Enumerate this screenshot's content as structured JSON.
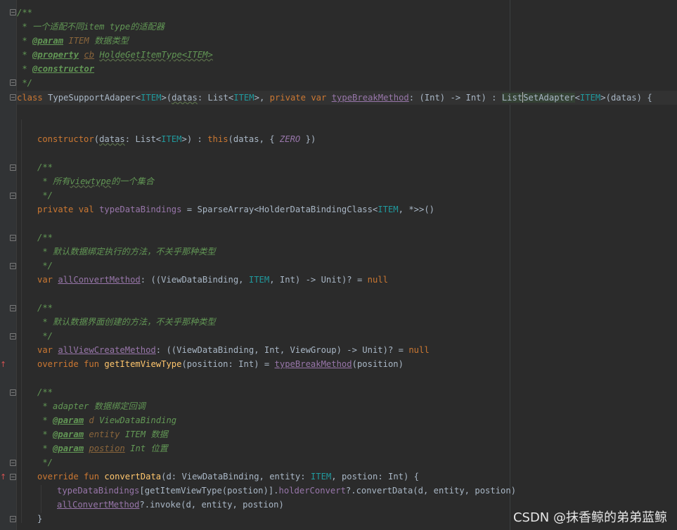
{
  "watermark": "CSDN @抹香鲸的弟弟蓝鲸",
  "lines": {
    "l1": "/**",
    "l2a": " * 一个适配不同",
    "l2b": "item type",
    "l2c": "的适配器",
    "l3a": " * ",
    "l3tag": "@param",
    "l3b": " ITEM ",
    "l3c": "数据类型",
    "l4a": " * ",
    "l4tag": "@property",
    "l4ref": "cb",
    "l4b": "HoldeGetItemType<ITEM>",
    "l5a": " * ",
    "l5tag": "@constructor",
    "l6": " */",
    "l7class": "class",
    "l7name": "TypeSupportAdaper",
    "l7gen1": "ITEM",
    "l7datas": "datas",
    "l7list": "List",
    "l7private": "private",
    "l7var": "var",
    "l7method": "typeBreakMethod",
    "l7sig": ": (Int) -> Int) : ",
    "l7list2a": "List",
    "l7list2b": "SetAdapter",
    "l7gen2": "ITEM",
    "l7end": ">(datas) {",
    "l10ctor": "constructor",
    "l10datas": "datas",
    "l10list": "List",
    "l10item": "ITEM",
    "l10this": "this",
    "l10zero": "ZERO",
    "l12": "/**",
    "l13a": " * 所有",
    "l13b": "viewtype",
    "l13c": "的一个集合",
    "l14": " */",
    "l15private": "private val",
    "l15name": "typeDataBindings",
    "l15rest": " = SparseArray<HolderDataBindingClass<",
    "l15item": "ITEM",
    "l15end": ", *>>()",
    "l17": "/**",
    "l18": " * 默认数据绑定执行的方法，不关乎那种类型",
    "l19": " */",
    "l20var": "var",
    "l20name": "allConvertMethod",
    "l20rest": ": ((ViewDataBinding, ",
    "l20item": "ITEM",
    "l20end": ", Int) -> Unit)? = ",
    "l20null": "null",
    "l22": "/**",
    "l23": " * 默认数据界面创建的方法，不关乎那种类型",
    "l24": " */",
    "l25var": "var",
    "l25name": "allViewCreateMethod",
    "l25rest": ": ((ViewDataBinding, Int, ViewGroup) -> Unit)? = ",
    "l25null": "null",
    "l26override": "override fun",
    "l26fn": "getItemViewType",
    "l26rest": "(position: Int) = ",
    "l26call": "typeBreakMethod",
    "l26end": "(position)",
    "l28": "/**",
    "l29a": " * adapter ",
    "l29b": "数据绑定回调",
    "l30a": " * ",
    "l30tag": "@param",
    "l30ref": " d ",
    "l30b": "ViewDataBinding",
    "l31a": " * ",
    "l31tag": "@param",
    "l31ref": " entity ",
    "l31b": "ITEM ",
    "l31c": "数据",
    "l32a": " * ",
    "l32tag": "@param",
    "l32ref": "postion",
    "l32b": " Int ",
    "l32c": "位置",
    "l33": " */",
    "l34override": "override fun",
    "l34fn": "convertData",
    "l34rest": "(d: ViewDataBinding, entity: ",
    "l34item": "ITEM",
    "l34end": ", postion: Int) {",
    "l35a": "typeDataBindings",
    "l35b": "[getItemViewType(postion)].",
    "l35c": "holderConvert",
    "l35d": "?.convertData(d, entity, postion)",
    "l36a": "allConvertMethod",
    "l36b": "?.invoke(d, entity, postion)",
    "l37": "}"
  },
  "colors": {
    "background": "#2b2b2b",
    "keyword": "#cc7832",
    "doc_comment": "#629755",
    "function": "#ffc66d",
    "property": "#9876aa",
    "generic": "#20999d",
    "default_text": "#a9b7c6"
  },
  "gutter_icons": [
    "fold-icon",
    "override-arrow-icon"
  ]
}
